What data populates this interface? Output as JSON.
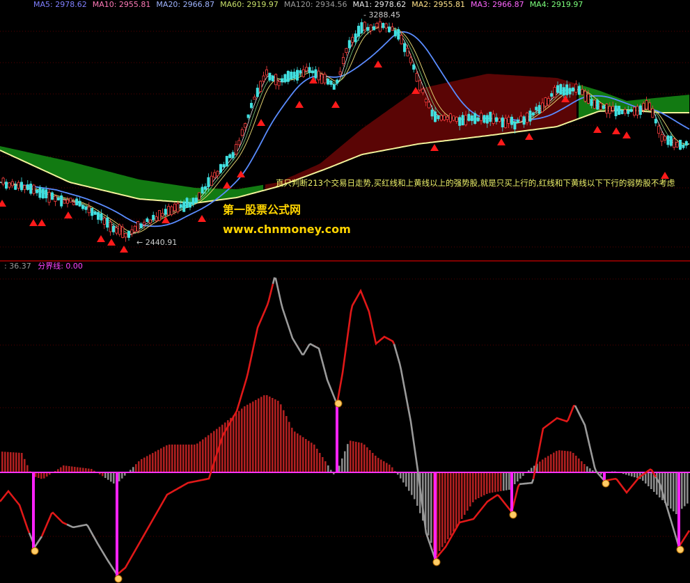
{
  "header": {
    "ma_items": [
      {
        "label": "MA5: 2978.62",
        "color": "#8080ff"
      },
      {
        "label": "MA10: 2955.81",
        "color": "#ff7ab8"
      },
      {
        "label": "MA20: 2966.87",
        "color": "#9fb4ff"
      },
      {
        "label": "MA60: 2919.97",
        "color": "#c8e06a"
      },
      {
        "label": "MA120: 2934.56",
        "color": "#9a9a9a"
      },
      {
        "label": "MA1: 2978.62",
        "color": "#e8e8e8"
      },
      {
        "label": "MA2: 2955.81",
        "color": "#ffe28a"
      },
      {
        "label": "MA3: 2966.87",
        "color": "#ff66ff"
      },
      {
        "label": "MA4: 2919.97",
        "color": "#7cff7c"
      }
    ]
  },
  "sub_header": {
    "value": ": 36.37",
    "divider": "分界线: 0.00",
    "value_color": "#9a9a9a",
    "divider_color": "#ff44ff"
  },
  "annotations": {
    "high_price": "3288.45",
    "low_price": "2440.91",
    "note": "直只判断213个交易日走势,买红线和上黄线以上的强势股,就是只买上行的,红线和下黄线以下下行的弱势股不考虑",
    "brand": "第一股票公式网",
    "url": "www.chnmoney.com"
  },
  "chart_data": {
    "type": "candlestick-with-indicator",
    "x": [],
    "main_series": [
      {
        "name": "MA5"
      },
      {
        "name": "MA10"
      },
      {
        "name": "MA20"
      },
      {
        "name": "MA60"
      },
      {
        "name": "MA120"
      },
      {
        "name": "MA1"
      },
      {
        "name": "MA2"
      },
      {
        "name": "MA3"
      },
      {
        "name": "MA4"
      }
    ],
    "price_extremes": {
      "high": 3288.45,
      "low": 2440.91
    },
    "indicator": {
      "divider_value": 0.0
    }
  }
}
